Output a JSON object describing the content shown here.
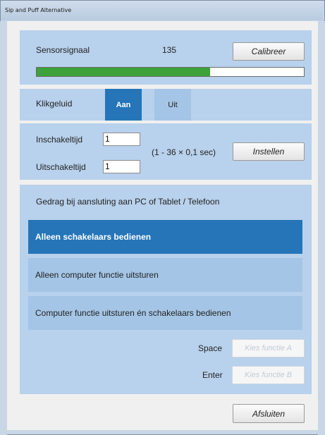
{
  "window": {
    "title": "Sip and Puff Alternative"
  },
  "sensor": {
    "label": "Sensorsignaal",
    "value": "135",
    "calibrate_label": "Calibreer",
    "level": 0.65,
    "fill_color": "#3ca23a"
  },
  "sound": {
    "label": "Klikgeluid",
    "on_label": "Aan",
    "off_label": "Uit",
    "selected": "Aan"
  },
  "timing": {
    "on_label": "Inschakeltijd",
    "on_value": "1",
    "off_label": "Uitschakeltijd",
    "off_value": "1",
    "range_text": "(1 - 36 × 0,1 sec)",
    "apply_label": "Instellen"
  },
  "behavior": {
    "heading": "Gedrag bij aansluting aan PC of Tablet / Telefoon",
    "options": [
      {
        "label": "Alleen schakelaars bedienen",
        "selected": true
      },
      {
        "label": "Alleen computer functie uitsturen",
        "selected": false
      },
      {
        "label": "Computer functie uitsturen én schakelaars bedienen",
        "selected": false
      }
    ],
    "space_label": "Space",
    "space_placeholder": "Kies functie A",
    "enter_label": "Enter",
    "enter_placeholder": "Kies functie B"
  },
  "footer": {
    "close_label": "Afsluiten"
  },
  "colors": {
    "accent": "#2575b8",
    "panel": "#b8d1ec",
    "option": "#a4c5e6"
  }
}
